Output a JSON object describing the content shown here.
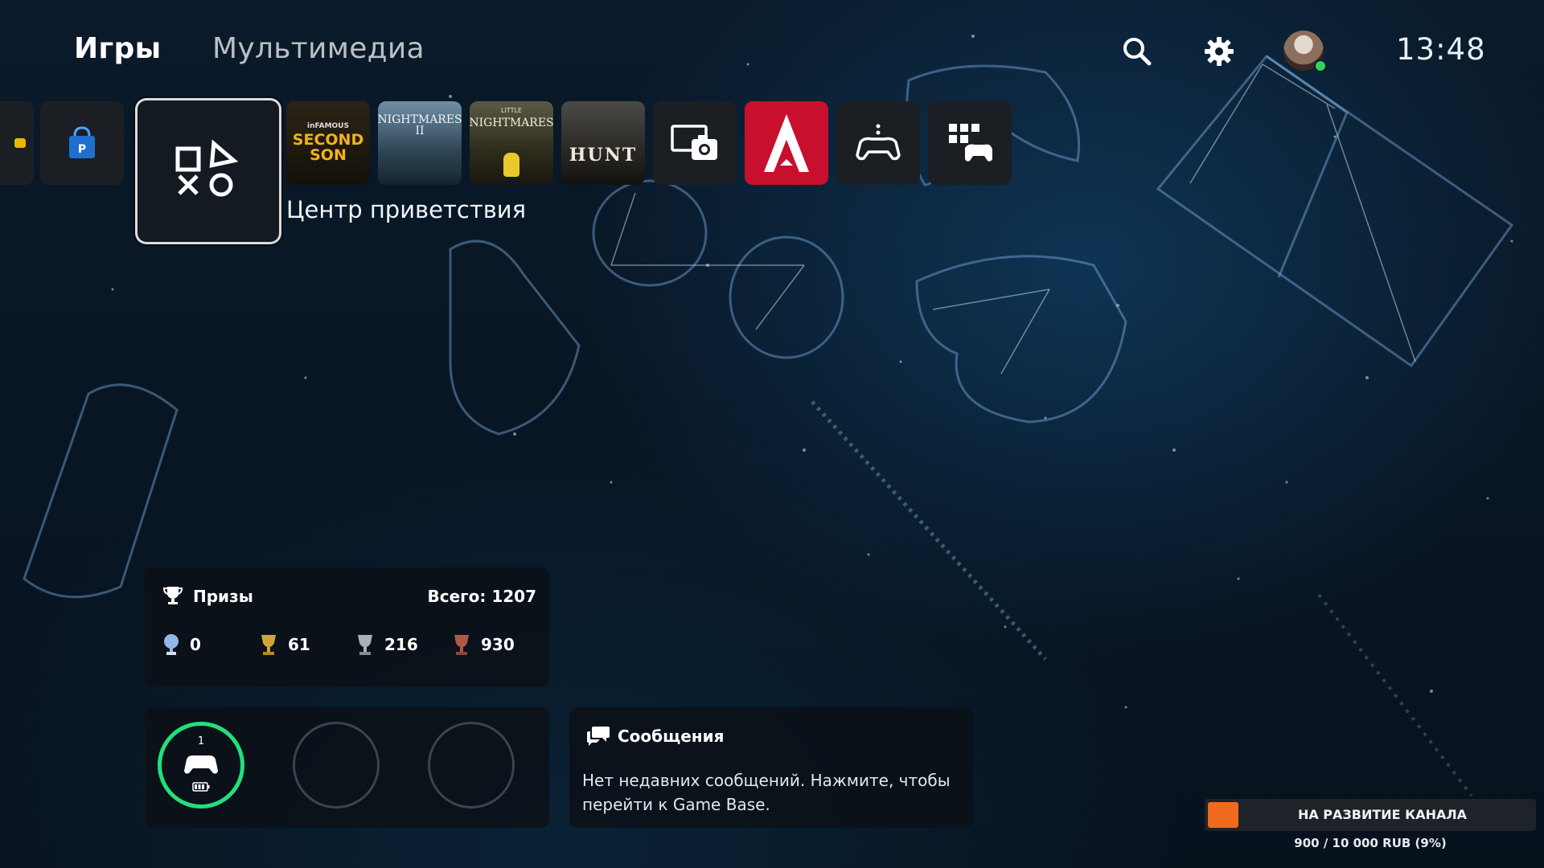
{
  "nav": {
    "tabs": [
      {
        "label": "Игры",
        "active": true
      },
      {
        "label": "Мультимедиа",
        "active": false
      }
    ],
    "icons": [
      "search-icon",
      "gear-icon"
    ],
    "clock": "13:48",
    "user_status": "online"
  },
  "tiles": {
    "selected_label": "Центр приветствия",
    "items": [
      {
        "name": "partial-tile",
        "color": "#e6b800"
      },
      {
        "name": "playstation-store",
        "color": "#1f6fd1"
      },
      {
        "name": "welcome-hub",
        "selected": true
      },
      {
        "name": "second-son",
        "top": "inFAMOUS",
        "title1": "SECOND",
        "title2": "SON"
      },
      {
        "name": "little-nightmares-2",
        "title": "NIGHTMARES",
        "sub": "II"
      },
      {
        "name": "little-nightmares",
        "top": "LITTLE",
        "title": "NIGHTMARES"
      },
      {
        "name": "hunt-showdown",
        "title": "HUNT"
      },
      {
        "name": "media-gallery"
      },
      {
        "name": "assassins-creed",
        "color": "#c8102e"
      },
      {
        "name": "controller-app"
      },
      {
        "name": "game-library"
      }
    ]
  },
  "trophies": {
    "title": "Призы",
    "total": "Всего: 1207",
    "counts": {
      "platinum": "0",
      "gold": "61",
      "silver": "216",
      "bronze": "930"
    },
    "colors": {
      "platinum": "#8fb8e8",
      "gold": "#d4a43a",
      "silver": "#a9b0b8",
      "bronze": "#b2564a"
    }
  },
  "controllers": {
    "player_number": "1",
    "active_ring_color": "#22e07a"
  },
  "messages": {
    "title": "Сообщения",
    "body": "Нет недавних сообщений. Нажмите, чтобы перейти к Game Base."
  },
  "donation": {
    "label": "НА РАЗВИТИЕ КАНАЛА",
    "amount": "900 / 10 000 RUB (9%)",
    "progress": 0.09,
    "color": "#f06a1e"
  }
}
